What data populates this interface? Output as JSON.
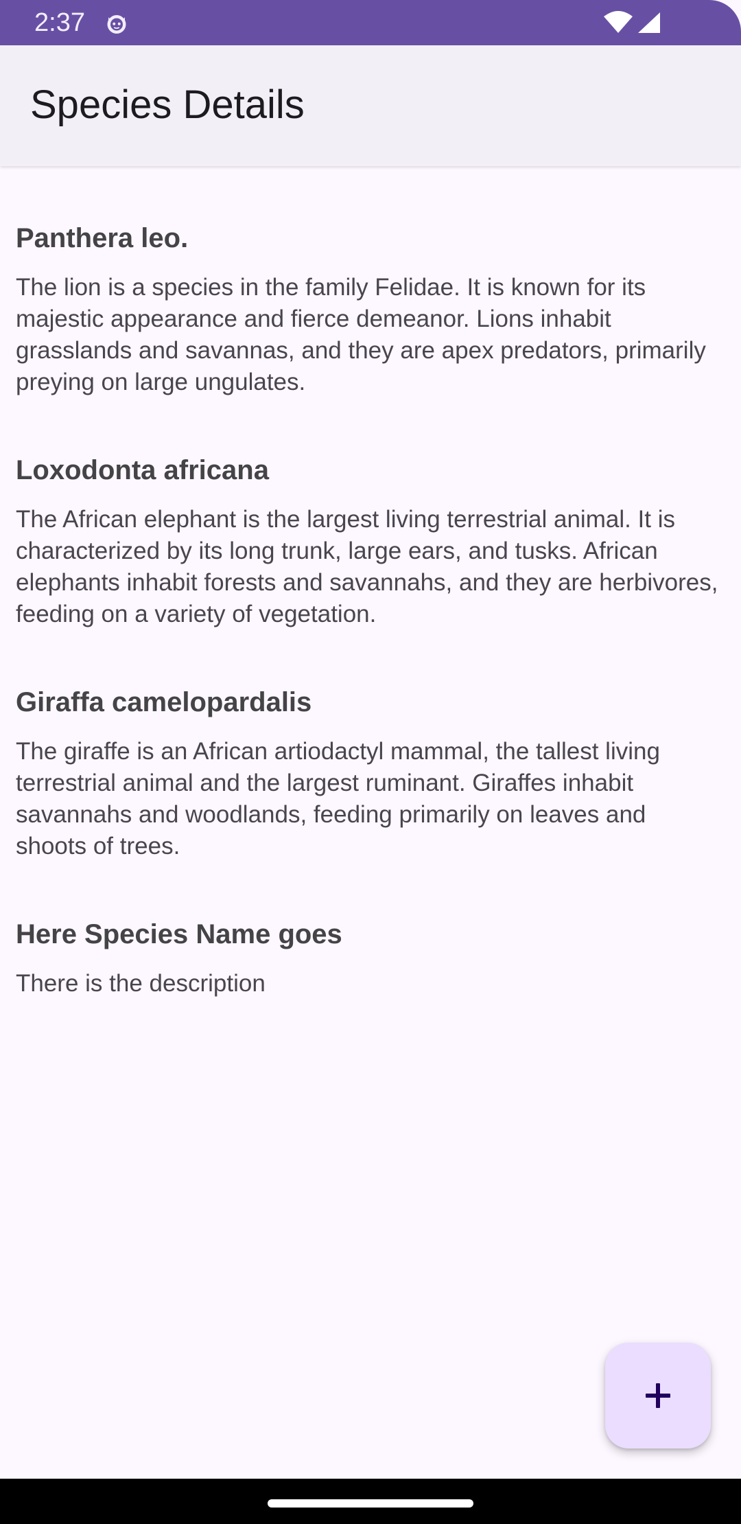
{
  "status_bar": {
    "time": "2:37",
    "notification_icon": "cat-face-icon",
    "wifi_icon": "wifi-icon",
    "signal_icon": "cell-signal-icon",
    "color": "#6750A4"
  },
  "app_bar": {
    "title": "Species Details"
  },
  "species": [
    {
      "name": "Panthera leo.",
      "description": "The lion is a species in the family Felidae. It is known for its majestic appearance and fierce demeanor. Lions inhabit grasslands and savannas, and they are apex predators, primarily preying on large ungulates."
    },
    {
      "name": "Loxodonta africana",
      "description": "The African elephant is the largest living terrestrial animal. It is characterized by its long trunk, large ears, and tusks. African elephants inhabit forests and savannahs, and they are herbivores, feeding on a variety of vegetation."
    },
    {
      "name": "Giraffa camelopardalis",
      "description": "The giraffe is an African artiodactyl mammal, the tallest living terrestrial animal and the largest ruminant. Giraffes inhabit savannahs and woodlands, feeding primarily on leaves and shoots of trees."
    },
    {
      "name": "Here Species Name goes",
      "description": "There is the description"
    }
  ],
  "fab": {
    "icon": "plus-icon",
    "color": "#EADDFF"
  },
  "nav_bar": {
    "handle": "home-gesture-handle"
  }
}
